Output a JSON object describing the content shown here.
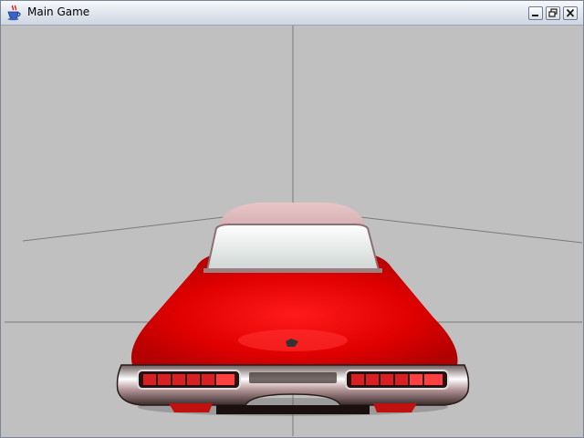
{
  "window": {
    "title": "Main Game",
    "icons": {
      "app": "java-coffee-cup-icon",
      "minimize": "minimize-icon",
      "maximize": "restore-icon",
      "close": "close-icon"
    }
  },
  "scene": {
    "background_color": "#c0c0c0",
    "car_color": "#e00000",
    "roof_color": "#d7a7aa",
    "grid_line_color": "#7a7a7a"
  }
}
